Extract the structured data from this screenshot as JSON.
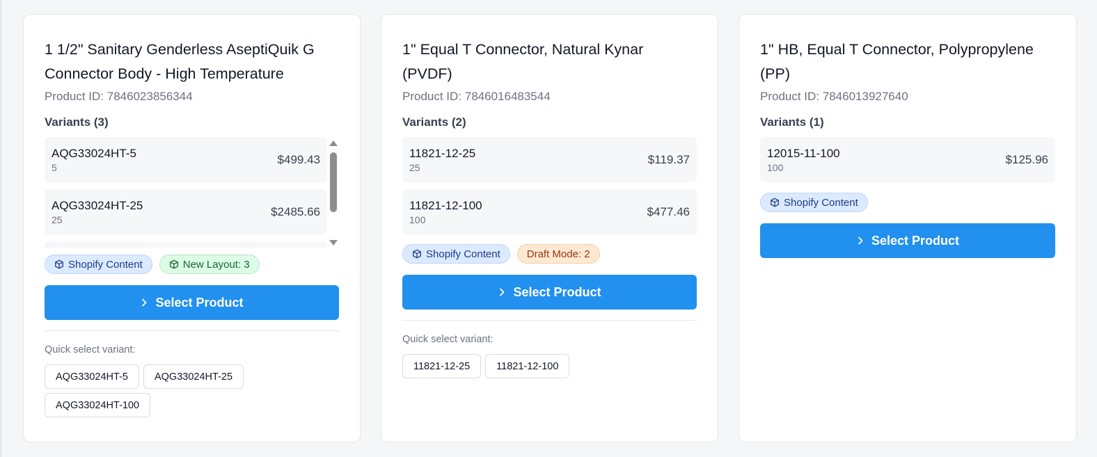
{
  "products": [
    {
      "title": "1 1/2\" Sanitary Genderless AseptiQuik G Connector Body - High Temperature",
      "product_id": "Product ID: 7846023856344",
      "variants_label": "Variants (3)",
      "variants": [
        {
          "sku": "AQG33024HT-5",
          "qty": "5",
          "price": "$499.43"
        },
        {
          "sku": "AQG33024HT-25",
          "qty": "25",
          "price": "$2485.66"
        }
      ],
      "badges": [
        {
          "label": "Shopify Content",
          "color": "#dbeafe"
        },
        {
          "label": "New Layout: 3",
          "color": "#dcfce7"
        }
      ],
      "button_label": "Select Product",
      "quick_label": "Quick select variant:",
      "quick_variants": [
        "AQG33024HT-5",
        "AQG33024HT-25",
        "AQG33024HT-100"
      ]
    },
    {
      "title": "1\" Equal T Connector, Natural Kynar (PVDF)",
      "product_id": "Product ID: 7846016483544",
      "variants_label": "Variants (2)",
      "variants": [
        {
          "sku": "11821-12-25",
          "qty": "25",
          "price": "$119.37"
        },
        {
          "sku": "11821-12-100",
          "qty": "100",
          "price": "$477.46"
        }
      ],
      "badges": [
        {
          "label": "Shopify Content",
          "color": "#dbeafe"
        },
        {
          "label": "Draft Mode: 2",
          "color": "#fde9d3"
        }
      ],
      "button_label": "Select Product",
      "quick_label": "Quick select variant:",
      "quick_variants": [
        "11821-12-25",
        "11821-12-100"
      ]
    },
    {
      "title": "1\" HB, Equal T Connector, Polypropylene (PP)",
      "product_id": "Product ID: 7846013927640",
      "variants_label": "Variants (1)",
      "variants": [
        {
          "sku": "12015-11-100",
          "qty": "100",
          "price": "$125.96"
        }
      ],
      "badges": [
        {
          "label": "Shopify Content",
          "color": "#dbeafe"
        }
      ],
      "button_label": "Select Product"
    }
  ],
  "colors": {
    "accent": "#2190ee",
    "page_background": "#f5f6f8",
    "card_background": "#ffffff"
  },
  "icons": {
    "badge": "box-icon",
    "button": "chevron-right-icon"
  }
}
